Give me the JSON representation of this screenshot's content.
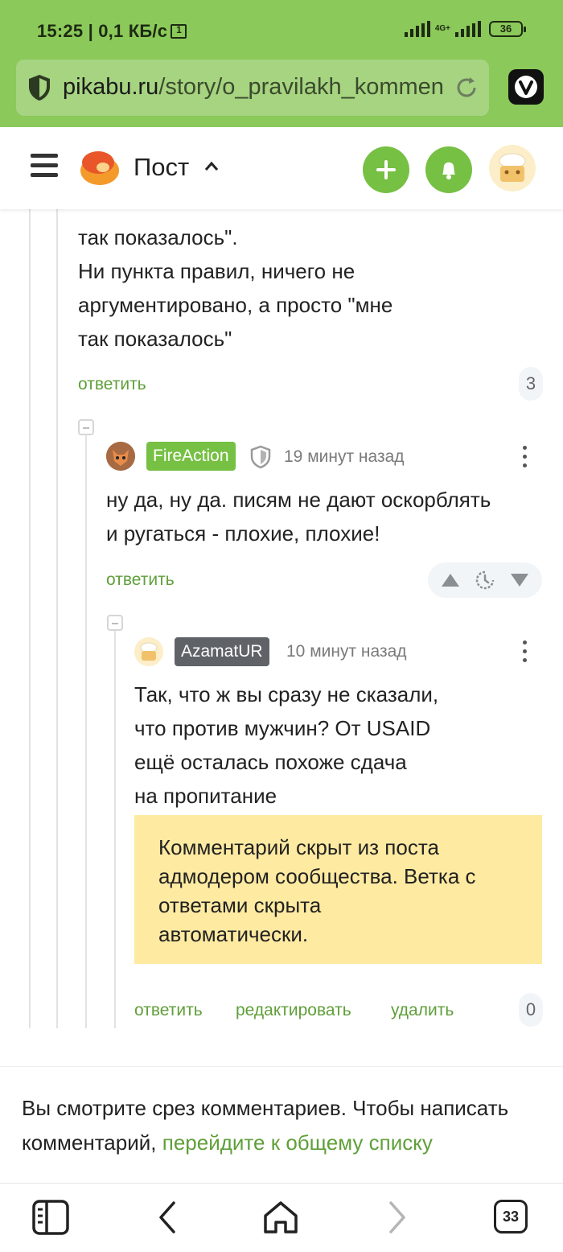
{
  "status_bar": {
    "time_speed": "15:25 | 0,1 КБ/с",
    "network": "4G+",
    "battery": "36"
  },
  "browser": {
    "url_domain": "pikabu.ru",
    "url_path": "/story/o_pravilakh_komment",
    "tabs_count": "33"
  },
  "header": {
    "title": "Пост"
  },
  "comment_parent": {
    "lines": [
      "так показалось\".",
      "Ни пункта правил, ничего не",
      "аргументировано, а просто \"мне",
      "так показалось\""
    ],
    "reply_label": "ответить",
    "replies_count": "3"
  },
  "comment_fireaction": {
    "nick": "FireAction",
    "time": "19 минут назад",
    "lines": [
      "ну да, ну да. писям не дают оскорблять",
      "и ругаться - плохие, плохие!"
    ],
    "reply_label": "ответить"
  },
  "comment_azamat": {
    "nick": "AzamatUR",
    "time": "10 минут назад",
    "lines": [
      "Так, что ж вы сразу не сказали,",
      "что против мужчин? От USAID",
      "ещё осталась похоже сдача",
      "на пропитание"
    ],
    "hidden_note": [
      "Комментарий скрыт из поста",
      "адмодером сообщества. Ветка с",
      "ответами скрыта",
      "автоматически."
    ],
    "reply_label": "ответить",
    "edit_label": "редактировать",
    "delete_label": "удалить",
    "replies_count": "0"
  },
  "footer_info": {
    "text": "Вы смотрите срез комментариев. Чтобы написать комментарий,",
    "link": "перейдите к общему списку"
  },
  "colors": {
    "brand_green": "#76c044",
    "status_green": "#8bc95a",
    "link_green": "#5f9f39",
    "fireaction_badge": "#76c044",
    "azamat_badge": "#5f6368",
    "hidden_note_bg": "#feeaa1"
  }
}
